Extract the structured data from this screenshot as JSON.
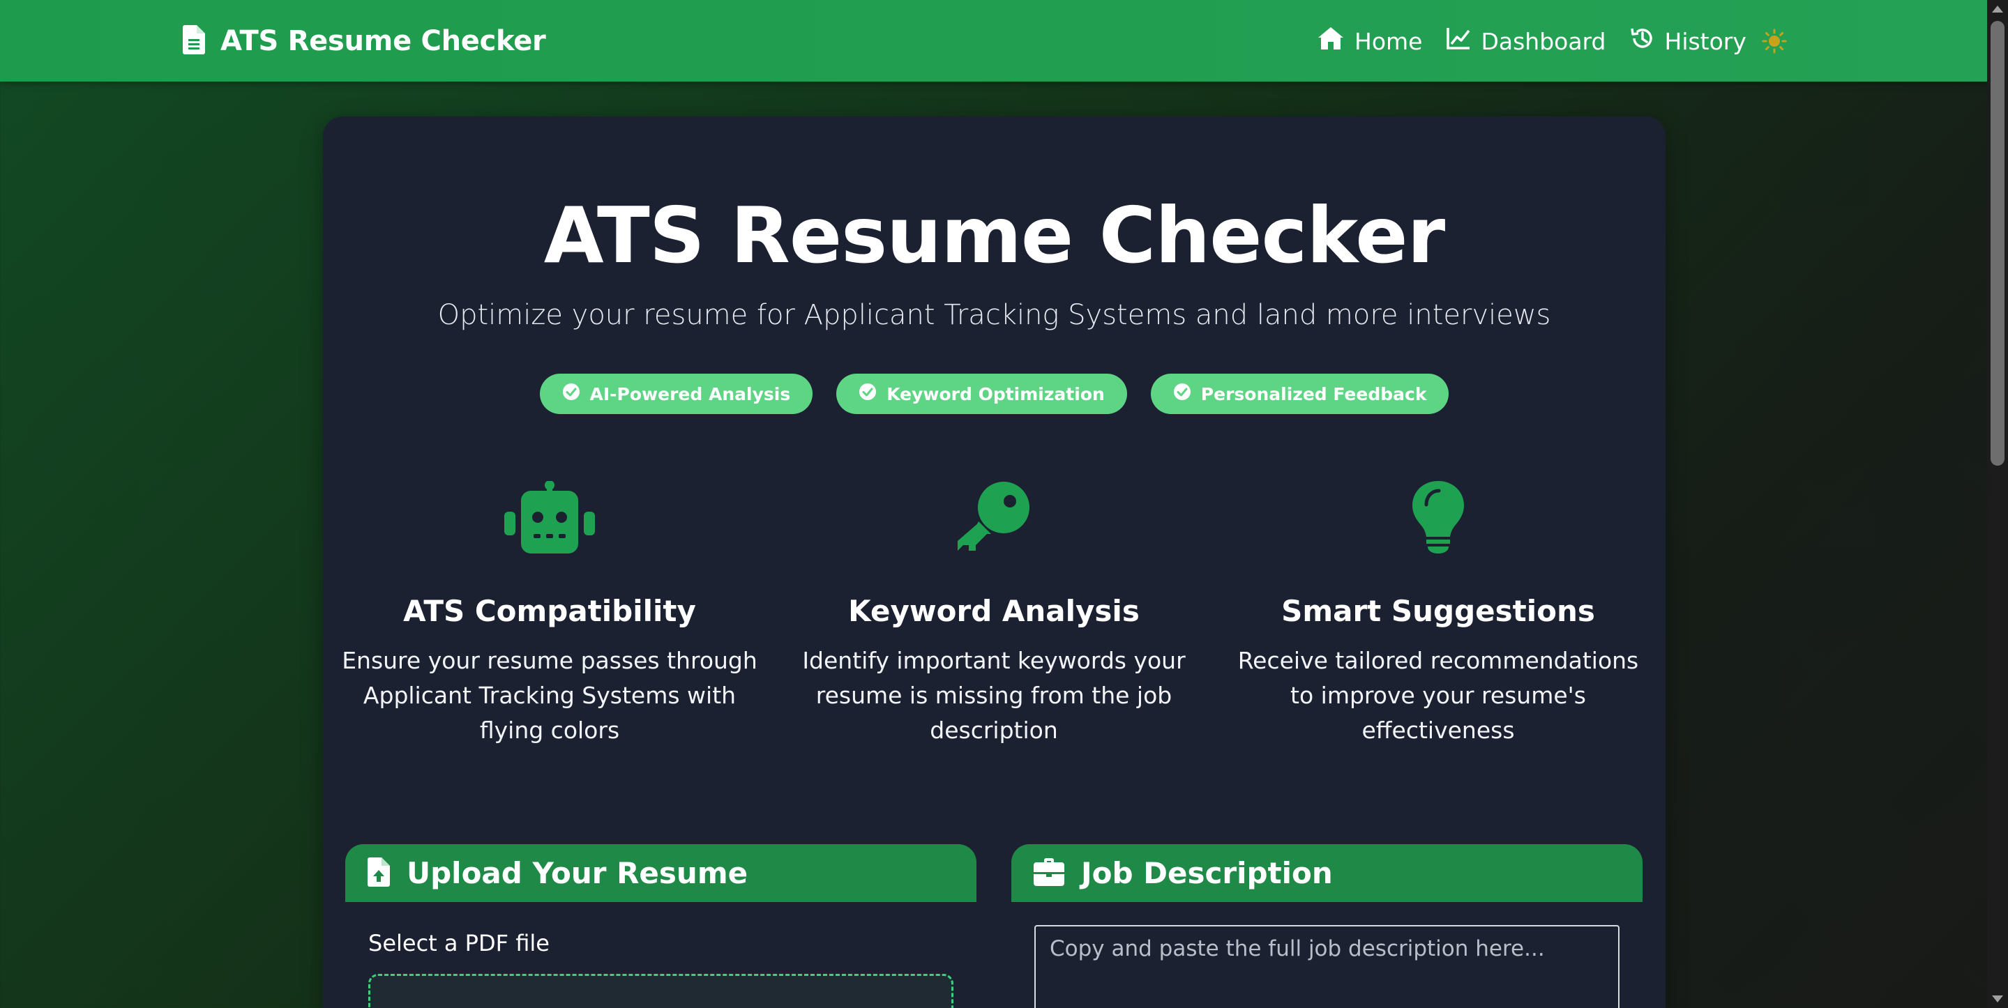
{
  "navbar": {
    "brand": "ATS Resume Checker",
    "links": [
      {
        "label": "Home",
        "icon": "home-icon"
      },
      {
        "label": "Dashboard",
        "icon": "chart-line-icon"
      },
      {
        "label": "History",
        "icon": "history-icon"
      }
    ],
    "theme_toggle_icon": "sun-icon"
  },
  "hero": {
    "title": "ATS Resume Checker",
    "subtitle": "Optimize your resume for Applicant Tracking Systems and land more interviews",
    "badges": [
      "AI-Powered Analysis",
      "Keyword Optimization",
      "Personalized Feedback"
    ]
  },
  "features": [
    {
      "icon": "robot-icon",
      "title": "ATS Compatibility",
      "description": "Ensure your resume passes through Applicant Tracking Systems with flying colors"
    },
    {
      "icon": "key-icon",
      "title": "Keyword Analysis",
      "description": "Identify important keywords your resume is missing from the job description"
    },
    {
      "icon": "lightbulb-icon",
      "title": "Smart Suggestions",
      "description": "Receive tailored recommendations to improve your resume's effectiveness"
    }
  ],
  "upload": {
    "title": "Upload Your Resume",
    "icon": "file-upload-icon",
    "label": "Select a PDF file"
  },
  "job": {
    "title": "Job Description",
    "icon": "briefcase-icon",
    "placeholder": "Copy and paste the full job description here..."
  },
  "colors": {
    "primary_green": "#24a154",
    "badge_green": "#5ed585",
    "icon_green": "#1fa152",
    "card_bg": "#1c2132",
    "panel_header": "#1f8a47",
    "sun_yellow": "#c8a21a"
  }
}
